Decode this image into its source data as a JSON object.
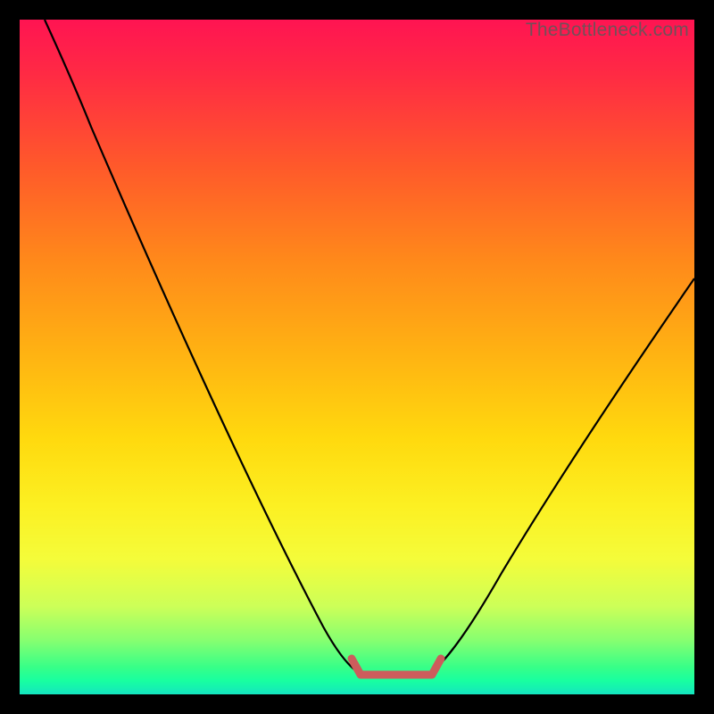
{
  "watermark": "TheBottleneck.com",
  "colors": {
    "curve": "#000000",
    "bracket": "#cc5c5c",
    "gradient_top": "#ff1452",
    "gradient_mid": "#ffd90e",
    "gradient_bottom": "#14e5c0"
  },
  "chart_data": {
    "type": "line",
    "title": "",
    "xlabel": "",
    "ylabel": "",
    "xlim": [
      0,
      100
    ],
    "ylim": [
      0,
      100
    ],
    "grid": false,
    "notes": "V-shaped black curve over a vertical red→orange→yellow→green gradient. No visible axes, ticks, or legend. A short coral bracket marks the flat minimum region. Values estimated from pixel positions (0–100 each axis, y=0 at bottom).",
    "series": [
      {
        "name": "left-branch",
        "x": [
          4,
          10,
          17,
          24,
          31,
          38,
          44,
          49,
          51
        ],
        "y": [
          100,
          88,
          76,
          62,
          48,
          33,
          18,
          6,
          3
        ]
      },
      {
        "name": "right-branch",
        "x": [
          60,
          63,
          68,
          74,
          80,
          87,
          93,
          100
        ],
        "y": [
          3,
          6,
          14,
          24,
          34,
          45,
          54,
          62
        ]
      }
    ],
    "highlight_bracket": {
      "x_start": 49,
      "x_end": 62,
      "y": 3
    }
  }
}
